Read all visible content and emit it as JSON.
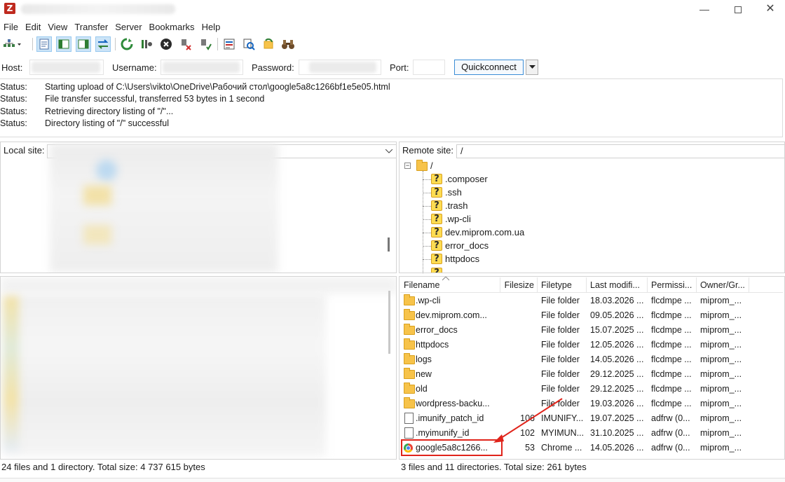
{
  "titlebar": {
    "app_icon_letter": "Z",
    "minimize_glyph": "—",
    "close_glyph": "✕"
  },
  "menu": {
    "items": [
      "File",
      "Edit",
      "View",
      "Transfer",
      "Server",
      "Bookmarks",
      "Help"
    ]
  },
  "quickconnect": {
    "host_label": "Host:",
    "username_label": "Username:",
    "password_label": "Password:",
    "port_label": "Port:",
    "button_label": "Quickconnect"
  },
  "log": [
    {
      "label": "Status:",
      "text": "Starting upload of C:\\Users\\vikto\\OneDrive\\Рабочий стол\\google5a8c1266bf1e5e05.html"
    },
    {
      "label": "Status:",
      "text": "File transfer successful, transferred 53 bytes in 1 second"
    },
    {
      "label": "Status:",
      "text": "Retrieving directory listing of \"/\"..."
    },
    {
      "label": "Status:",
      "text": "Directory listing of \"/\" successful"
    }
  ],
  "local": {
    "site_label": "Local site:",
    "status": "24 files and 1 directory. Total size: 4 737 615 bytes"
  },
  "remote": {
    "site_label": "Remote site:",
    "site_path": "/",
    "tree_root": "/",
    "tree_items": [
      ".composer",
      ".ssh",
      ".trash",
      ".wp-cli",
      "dev.miprom.com.ua",
      "error_docs",
      "httpdocs"
    ],
    "columns": [
      "Filename",
      "Filesize",
      "Filetype",
      "Last modifi...",
      "Permissi...",
      "Owner/Gr..."
    ],
    "files": [
      {
        "name": ".wp-cli",
        "size": "",
        "type": "File folder",
        "modified": "18.03.2026 ...",
        "perms": "flcdmpe ...",
        "owner": "miprom_...",
        "icon": "folder"
      },
      {
        "name": "dev.miprom.com...",
        "size": "",
        "type": "File folder",
        "modified": "09.05.2026 ...",
        "perms": "flcdmpe ...",
        "owner": "miprom_...",
        "icon": "folder"
      },
      {
        "name": "error_docs",
        "size": "",
        "type": "File folder",
        "modified": "15.07.2025 ...",
        "perms": "flcdmpe ...",
        "owner": "miprom_...",
        "icon": "folder"
      },
      {
        "name": "httpdocs",
        "size": "",
        "type": "File folder",
        "modified": "12.05.2026 ...",
        "perms": "flcdmpe ...",
        "owner": "miprom_...",
        "icon": "folder"
      },
      {
        "name": "logs",
        "size": "",
        "type": "File folder",
        "modified": "14.05.2026 ...",
        "perms": "flcdmpe ...",
        "owner": "miprom_...",
        "icon": "folder"
      },
      {
        "name": "new",
        "size": "",
        "type": "File folder",
        "modified": "29.12.2025 ...",
        "perms": "flcdmpe ...",
        "owner": "miprom_...",
        "icon": "folder"
      },
      {
        "name": "old",
        "size": "",
        "type": "File folder",
        "modified": "29.12.2025 ...",
        "perms": "flcdmpe ...",
        "owner": "miprom_...",
        "icon": "folder"
      },
      {
        "name": "wordpress-backu...",
        "size": "",
        "type": "File folder",
        "modified": "19.03.2026 ...",
        "perms": "flcdmpe ...",
        "owner": "miprom_...",
        "icon": "folder"
      },
      {
        "name": ".imunify_patch_id",
        "size": "106",
        "type": "IMUNIFY...",
        "modified": "19.07.2025 ...",
        "perms": "adfrw (0...",
        "owner": "miprom_...",
        "icon": "file"
      },
      {
        "name": ".myimunify_id",
        "size": "102",
        "type": "MYIMUN...",
        "modified": "31.10.2025 ...",
        "perms": "adfrw (0...",
        "owner": "miprom_...",
        "icon": "file"
      },
      {
        "name": "google5a8c1266...",
        "size": "53",
        "type": "Chrome ...",
        "modified": "14.05.2026 ...",
        "perms": "adfrw (0...",
        "owner": "miprom_...",
        "icon": "chrome"
      }
    ],
    "status": "3 files and 11 directories. Total size: 261 bytes"
  },
  "colors": {
    "highlight": "#e0241b",
    "folder": "#f7c34a",
    "accent": "#3b8dd6"
  }
}
